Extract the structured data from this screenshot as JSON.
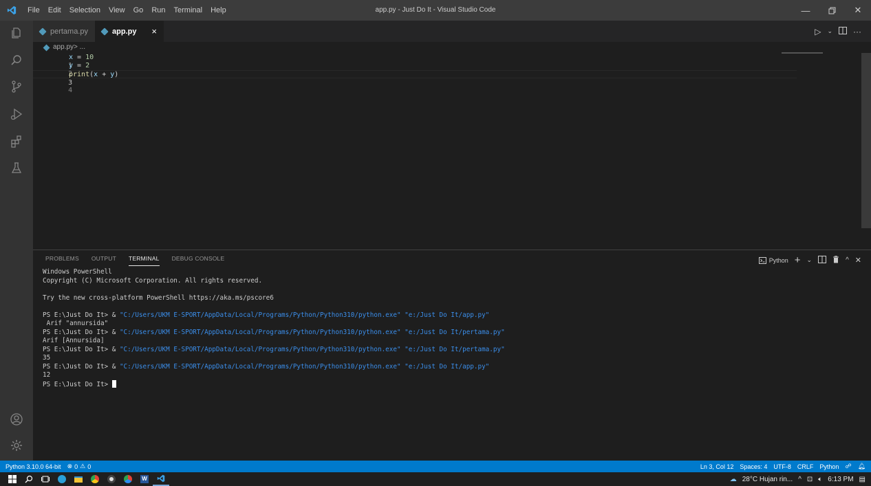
{
  "window": {
    "title": "app.py - Just Do It - Visual Studio Code"
  },
  "menu": [
    "File",
    "Edit",
    "Selection",
    "View",
    "Go",
    "Run",
    "Terminal",
    "Help"
  ],
  "activity_bar": {
    "top": [
      "explorer-icon",
      "search-icon",
      "source-control-icon",
      "run-debug-icon",
      "extensions-icon",
      "testing-icon"
    ],
    "bottom": [
      "accounts-icon",
      "settings-gear-icon"
    ]
  },
  "tabs": [
    {
      "label": "pertama.py",
      "active": false
    },
    {
      "label": "app.py",
      "active": true,
      "close": "×"
    }
  ],
  "breadcrumb": {
    "file": "app.py",
    "rest": " > ..."
  },
  "code_lines": [
    {
      "num": "1",
      "text": "x = 10"
    },
    {
      "num": "2",
      "text": "y = 2"
    },
    {
      "num": "3",
      "text": "print(x + y)"
    },
    {
      "num": "4",
      "text": ""
    }
  ],
  "panel": {
    "tabs": [
      "PROBLEMS",
      "OUTPUT",
      "TERMINAL",
      "DEBUG CONSOLE"
    ],
    "active_tab": "TERMINAL",
    "terminal_selector": "Python"
  },
  "terminal": {
    "lines": [
      {
        "text": "Windows PowerShell"
      },
      {
        "text": "Copyright (C) Microsoft Corporation. All rights reserved."
      },
      {
        "text": ""
      },
      {
        "text": "Try the new cross-platform PowerShell https://aka.ms/pscore6"
      },
      {
        "text": ""
      },
      {
        "prompt": "PS E:\\Just Do It> & ",
        "cmd": "\"C:/Users/UKM E-SPORT/AppData/Local/Programs/Python/Python310/python.exe\" \"e:/Just Do It/app.py\""
      },
      {
        "text": " Arif \"annursida\""
      },
      {
        "prompt": "PS E:\\Just Do It> & ",
        "cmd": "\"C:/Users/UKM E-SPORT/AppData/Local/Programs/Python/Python310/python.exe\" \"e:/Just Do It/pertama.py\""
      },
      {
        "text": "Arif [Annursida]"
      },
      {
        "prompt": "PS E:\\Just Do It> & ",
        "cmd": "\"C:/Users/UKM E-SPORT/AppData/Local/Programs/Python/Python310/python.exe\" \"e:/Just Do It/pertama.py\""
      },
      {
        "text": "35"
      },
      {
        "prompt": "PS E:\\Just Do It> & ",
        "cmd": "\"C:/Users/UKM E-SPORT/AppData/Local/Programs/Python/Python310/python.exe\" \"e:/Just Do It/app.py\""
      },
      {
        "text": "12"
      },
      {
        "prompt": "PS E:\\Just Do It> ",
        "cursor": true
      }
    ]
  },
  "status_bar": {
    "interpreter": "Python 3.10.0 64-bit",
    "errors": "0",
    "warnings": "0",
    "position": "Ln 3, Col 12",
    "spaces": "Spaces: 4",
    "encoding": "UTF-8",
    "eol": "CRLF",
    "language": "Python"
  },
  "taskbar": {
    "weather": "28°C  Hujan rin...",
    "time": "6:13 PM"
  },
  "colors": {
    "accent": "#007acc",
    "editor_bg": "#1e1e1e",
    "activity_bg": "#333333",
    "titlebar_bg": "#3c3c3c"
  }
}
